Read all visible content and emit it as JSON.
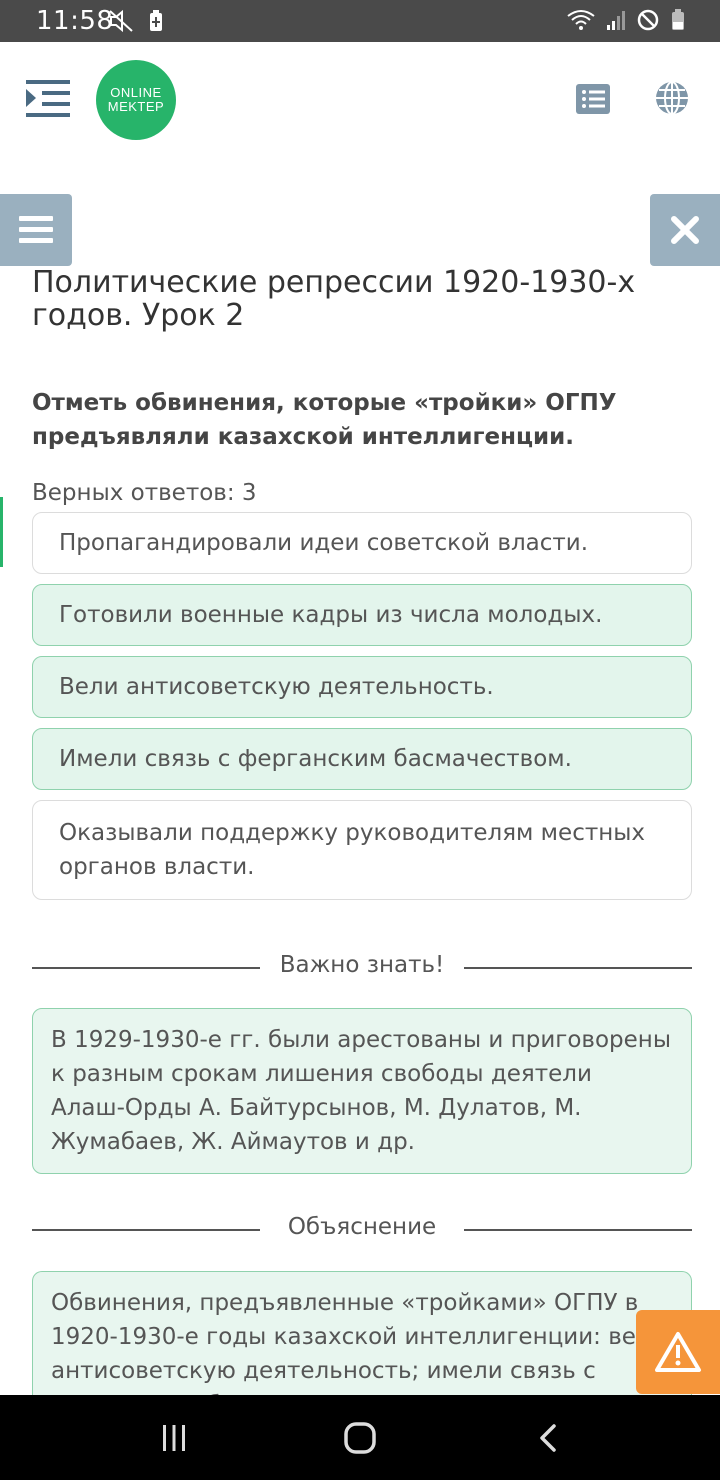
{
  "status_bar": {
    "time": "11:58",
    "icons_left": [
      "mute-icon",
      "battery-saver-icon"
    ],
    "icons_right": [
      "wifi-icon",
      "signal-icon",
      "dnd-icon",
      "battery-icon"
    ]
  },
  "header": {
    "logo_line1": "ONLINE",
    "logo_line2": "MEKTEP",
    "brand_color": "#27b46a"
  },
  "lesson": {
    "title": "Политические репрессии 1920-1930-х годов. Урок 2"
  },
  "question": {
    "text": "Отметь обвинения, которые «тройки» ОГПУ предъявляли казахской интеллигенции.",
    "answer_count": "Верных ответов: 3",
    "options": [
      {
        "label": "Пропагандировали идеи советской власти.",
        "selected": false
      },
      {
        "label": "Готовили военные кадры из числа молодых.",
        "selected": true
      },
      {
        "label": "Вели антисоветскую деятельность.",
        "selected": true
      },
      {
        "label": "Имели связь с ферганским басмачеством.",
        "selected": true
      },
      {
        "label": "Оказывали поддержку руководителям местных органов власти.",
        "selected": false
      }
    ]
  },
  "important": {
    "heading": "Важно знать!",
    "text": "В 1929-1930-е гг. были арестованы и приговорены к разным срокам лишения свободы деятели Алаш-Орды А. Байтурсынов, М. Дулатов, М. Жумабаев, Ж. Аймаутов и др."
  },
  "explanation": {
    "heading": "Объяснение",
    "text": "Обвинения, предъявленные «тройками» ОГПУ в 1920-1930-е годы казахской интеллигенции: вели антисоветскую деятельность; имели связь с ферганским басмачеством"
  },
  "colors": {
    "status_bar": "#4a4a4a",
    "side_button": "#9ab0bf",
    "selected_bg": "#e3f5ec",
    "selected_border": "#8fd2ad",
    "warning": "#f5953a"
  }
}
